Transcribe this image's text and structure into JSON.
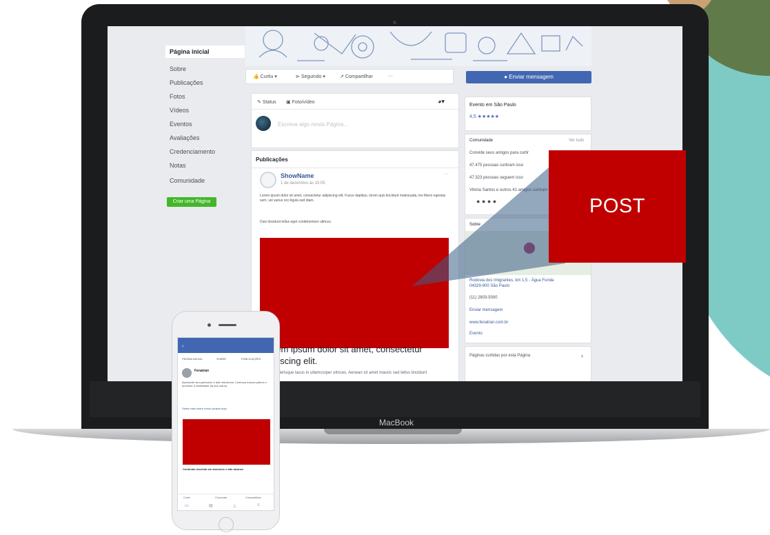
{
  "sidebar": {
    "items": [
      {
        "label": "Página inicial",
        "active": true
      },
      {
        "label": "Sobre"
      },
      {
        "label": "Publicações"
      },
      {
        "label": "Fotos"
      },
      {
        "label": "Vídeos"
      },
      {
        "label": "Eventos"
      },
      {
        "label": "Avaliações"
      },
      {
        "label": "Credenciamento"
      },
      {
        "label": "Notas"
      },
      {
        "label": "Comunidade"
      }
    ],
    "create_page_label": "Criar uma Página"
  },
  "action_bar": {
    "like": "Curtiu",
    "follow": "Seguindo",
    "share": "Compartilhar",
    "more": "···",
    "send_message": "Enviar mensagem"
  },
  "composer": {
    "mode_write": "Status",
    "mode_photo": "Foto/vídeo",
    "placeholder": "Escreva algo nesta Página..."
  },
  "posts": {
    "section_title": "Publicações",
    "author": "ShowName",
    "date": "1 de dezembro às 15:05",
    "body": "Lorem ipsum dolor sit amet, consectetur adipiscing elit. Fusce dapibus, lorem quis tincidunt malesuada, leo libero egestas sem, vel varius orci ligula sed diam.",
    "secondary": "Duis tincidunt tellus eget condimentum ultrices.",
    "headline": "rem ipsum dolor sit amet, consectetur\npiscing elit.",
    "subline": "scelerisque lacus in ullamcorper ultrices. Aenean sit amet mauris sed tellus tincidunt"
  },
  "right_column": {
    "rating_title": "Evento em São Paulo",
    "rating_value": "4,5 ★★★★★",
    "community_title": "Comunidade",
    "community_link": "Ver tudo",
    "community_items": [
      "Convide seus amigos para curtir",
      "47.475 pessoas curtiram isso",
      "47.323 pessoas seguem isso",
      "Vitoria Santos e outros 41 amigos curtiram isso"
    ],
    "about_title": "Sobre",
    "address": "Rodovia dos Imigrantes, km 1,5 - Água Funda\n04329-900 São Paulo",
    "phone": "(11) 2803-5000",
    "send_message": "Enviar mensagem",
    "website": "www.fenatran.com.br",
    "category": "Evento",
    "liked_pages": "Páginas curtidas por esta Página"
  },
  "callout": {
    "label": "POST",
    "color": "#c00000"
  },
  "laptop": {
    "label": "MacBook"
  },
  "phone": {
    "tabs": [
      "PÁGINA INICIAL",
      "SOBRE",
      "PUBLICAÇÕES"
    ],
    "author": "Fenatran",
    "post_text": "Apresente seu patrocínio e alta relevância. Conheça nossos planos e aumente a visibilidade da sua marca.",
    "link_text": "Saiba mais sobre nosso projeto aqui",
    "card_title": "Conteúdo inserido em anúncios e alto alcance",
    "actions": [
      "Curtir",
      "Comentar",
      "Compartilhar"
    ]
  }
}
